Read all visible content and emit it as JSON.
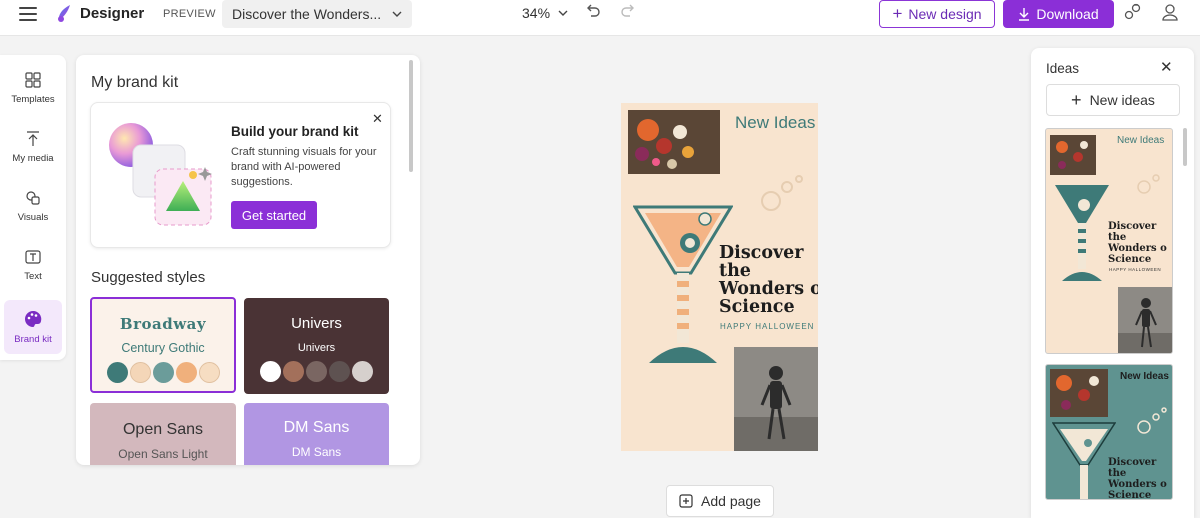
{
  "header": {
    "app_name": "Designer",
    "badge": "PREVIEW",
    "doc_name": "Discover the Wonders...",
    "zoom": "34%",
    "new_design": "New design",
    "download": "Download"
  },
  "rail": {
    "items": [
      {
        "label": "Templates"
      },
      {
        "label": "My media"
      },
      {
        "label": "Visuals"
      },
      {
        "label": "Text"
      },
      {
        "label": "Brand kit"
      }
    ]
  },
  "panel": {
    "title": "My brand kit",
    "card": {
      "title": "Build your brand kit",
      "description": "Craft stunning visuals for your brand with AI-powered suggestions.",
      "button": "Get started"
    },
    "suggested_title": "Suggested styles",
    "styles": [
      {
        "heading": "Broadway",
        "sub": "Century Gothic",
        "swatches": [
          "#3e7a78",
          "#f4d6b8",
          "#6b9c9a",
          "#f0b07c",
          "#f6ddc2"
        ]
      },
      {
        "heading": "Univers",
        "sub": "Univers",
        "swatches": [
          "#ffffff",
          "#a3705b",
          "#7a6662",
          "#5e5251",
          "#d6d0cd"
        ]
      },
      {
        "heading": "Open Sans",
        "sub": "Open Sans Light"
      },
      {
        "heading": "DM Sans",
        "sub": "DM Sans"
      }
    ]
  },
  "canvas": {
    "headline": "New Ideas",
    "title_lines": [
      "Discover",
      "the",
      "Wonders o",
      "Science"
    ],
    "subtitle": "HAPPY HALLOWEEN",
    "add_page": "Add page"
  },
  "ideas": {
    "title": "Ideas",
    "new_ideas": "New ideas",
    "thumb1": {
      "headline": "New Ideas",
      "title_lines": [
        "Discover",
        "the",
        "Wonders o",
        "Science"
      ],
      "subtitle": "HAPPY HALLOWEEN"
    },
    "thumb2": {
      "headline": "New Ideas",
      "title_lines": [
        "Discover",
        "the",
        "Wonders o",
        "Science"
      ]
    }
  },
  "colors": {
    "accent": "#8b2fd7",
    "poster_bg": "#f8e4cf",
    "teal": "#3e7a78"
  }
}
